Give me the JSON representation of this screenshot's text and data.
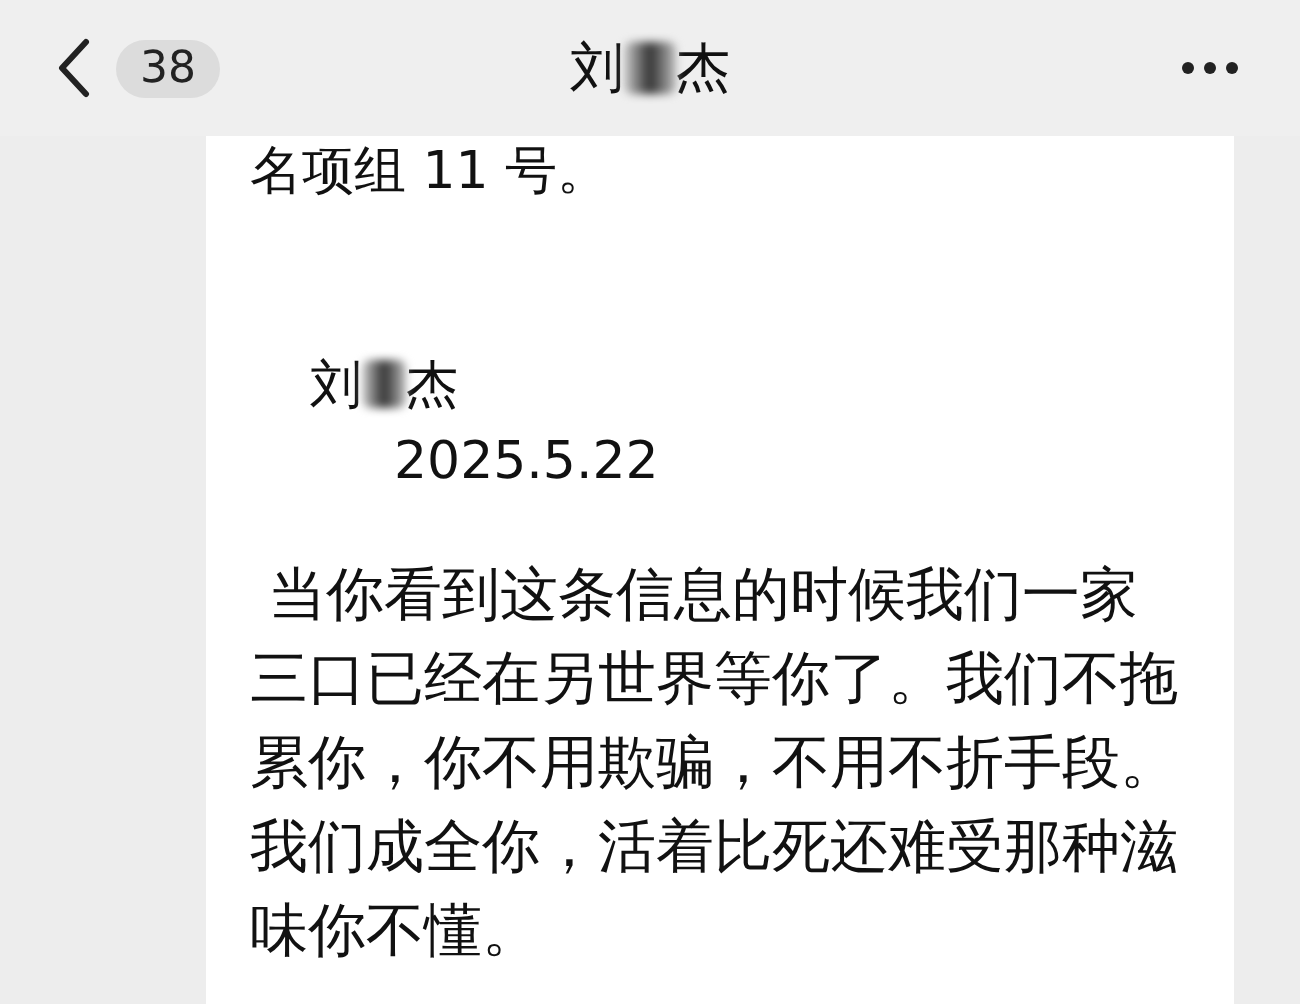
{
  "header": {
    "unread_count": "38",
    "title": {
      "before": "刘",
      "after": "杰"
    }
  },
  "message": {
    "top_line": "名项组 11 号。",
    "signature": {
      "before": "刘",
      "after": "杰"
    },
    "date": "2025.5.22",
    "paragraph": " 当你看到这条信息的时候我们一家三口已经在另世界等你了。我们不拖累你，你不用欺骗，不用不折手段。我们成全你，活着比死还难受那种滋味你不懂。"
  }
}
